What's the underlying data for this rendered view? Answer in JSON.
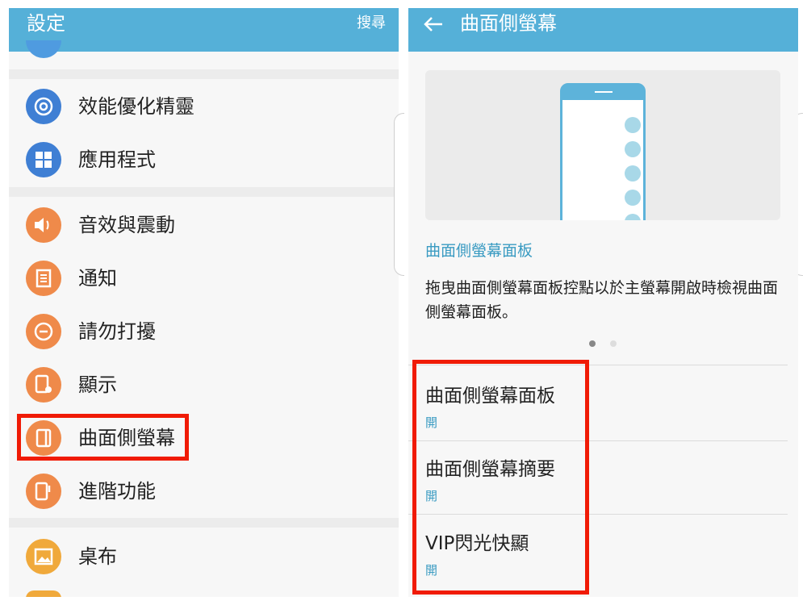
{
  "left": {
    "title": "設定",
    "search_label": "搜尋",
    "items": [
      {
        "label": "效能優化精靈",
        "icon": "performance-icon"
      },
      {
        "label": "應用程式",
        "icon": "apps-icon"
      },
      {
        "label": "音效與震動",
        "icon": "sound-icon"
      },
      {
        "label": "通知",
        "icon": "notification-icon"
      },
      {
        "label": "請勿打擾",
        "icon": "do-not-disturb-icon"
      },
      {
        "label": "顯示",
        "icon": "display-icon"
      },
      {
        "label": "曲面側螢幕",
        "icon": "edge-screen-icon"
      },
      {
        "label": "進階功能",
        "icon": "advanced-features-icon"
      },
      {
        "label": "桌布",
        "icon": "wallpaper-icon"
      }
    ]
  },
  "right": {
    "title": "曲面側螢幕",
    "section_title": "曲面側螢幕面板",
    "description": "拖曳曲面側螢幕面板控點以於主螢幕開啟時檢視曲面側螢幕面板。",
    "settings": [
      {
        "title": "曲面側螢幕面板",
        "status": "開"
      },
      {
        "title": "曲面側螢幕摘要",
        "status": "開"
      },
      {
        "title": "VIP閃光快顯",
        "status": "開"
      }
    ]
  },
  "colors": {
    "appbar": "#55b0d8",
    "highlight": "#f01b06",
    "accent_text": "#3a9bc2",
    "icon_blue": "#3f7fd4",
    "icon_orange": "#ef8a4a",
    "icon_yellow": "#f0a93b"
  }
}
